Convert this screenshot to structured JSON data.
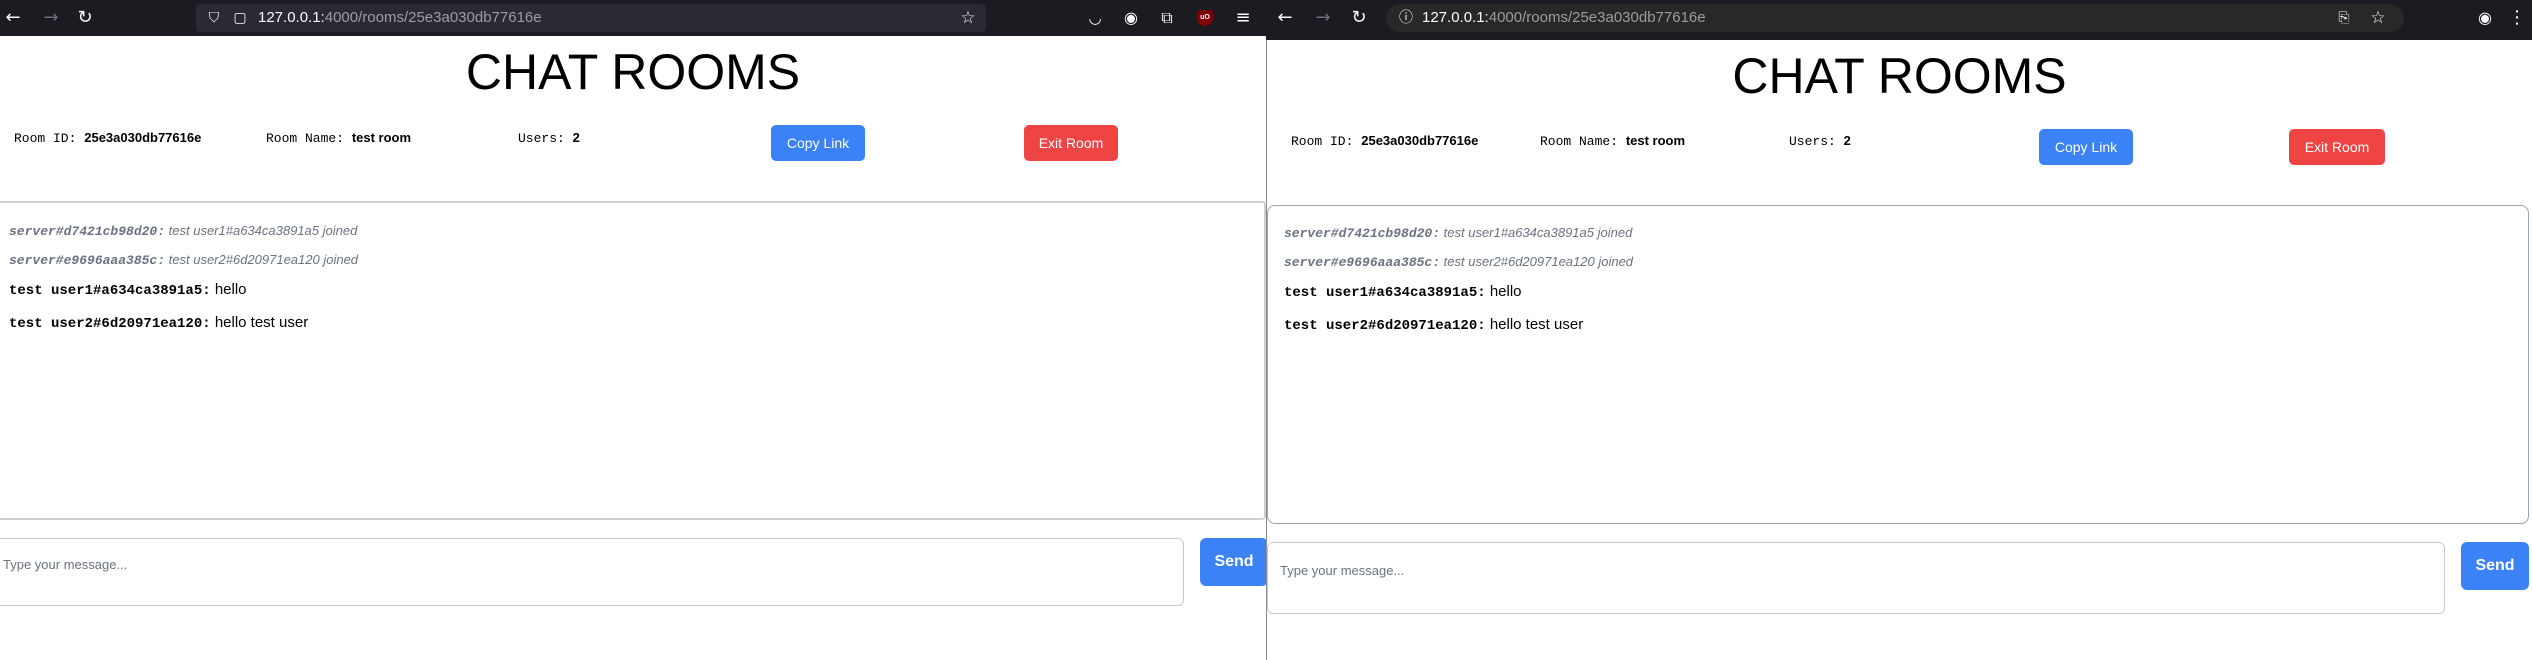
{
  "firefox": {
    "url_host": "127.0.0.1:",
    "url_path": "4000/rooms/25e3a030db77616e",
    "ublock_label": "uO"
  },
  "chrome": {
    "url_host": "127.0.0.1:",
    "url_path": "4000/rooms/25e3a030db77616e"
  },
  "page": {
    "title": "CHAT ROOMS",
    "room_id_label": "Room ID:",
    "room_id": "25e3a030db77616e",
    "room_name_label": "Room Name:",
    "room_name": "test room",
    "users_label": "Users:",
    "users_count": "2",
    "copy_link_label": "Copy Link",
    "exit_room_label": "Exit Room",
    "messages": [
      {
        "type": "server",
        "sender": "server#d7421cb98d20:",
        "text": "test user1#a634ca3891a5 joined"
      },
      {
        "type": "server",
        "sender": "server#e9696aaa385c:",
        "text": "test user2#6d20971ea120 joined"
      },
      {
        "type": "user",
        "sender": "test user1#a634ca3891a5:",
        "text": "hello"
      },
      {
        "type": "user",
        "sender": "test user2#6d20971ea120:",
        "text": "hello test user"
      }
    ],
    "input_placeholder": "Type your message...",
    "send_label": "Send"
  }
}
